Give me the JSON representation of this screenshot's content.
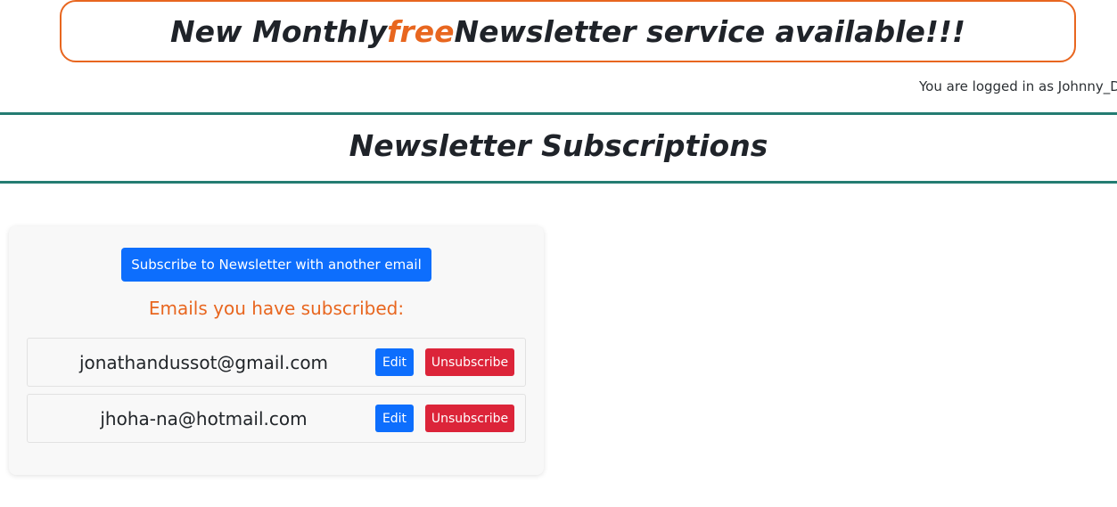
{
  "banner": {
    "prefix": "New Monthly ",
    "accent": "free",
    "suffix": " Newsletter service available!!!"
  },
  "session": {
    "logged_in_text": "You are logged in as Johnny_D"
  },
  "page": {
    "title": "Newsletter Subscriptions"
  },
  "subscriptions": {
    "subscribe_button_label": "Subscribe to Newsletter with another email",
    "heading": "Emails you have subscribed:",
    "emails": [
      {
        "address": "jonathandussot@gmail.com",
        "edit_label": "Edit",
        "unsubscribe_label": "Unsubscribe"
      },
      {
        "address": "jhoha-na@hotmail.com",
        "edit_label": "Edit",
        "unsubscribe_label": "Unsubscribe"
      }
    ]
  },
  "colors": {
    "accent_orange": "#e8661f",
    "primary_blue": "#0d6efd",
    "danger_red": "#dc2439",
    "rule_teal": "#247c72"
  }
}
